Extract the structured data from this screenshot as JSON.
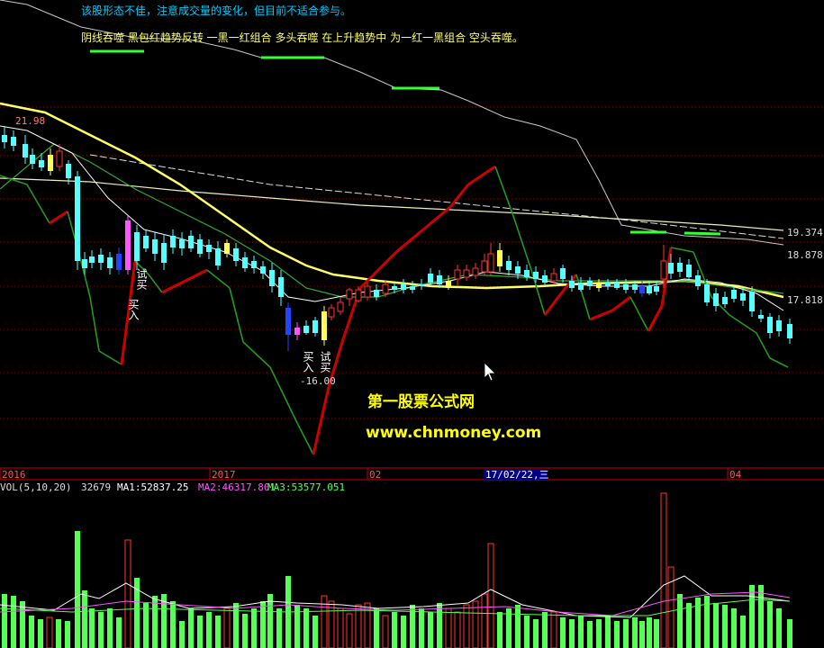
{
  "header": {
    "line1": "该股形态不佳，注意成交量的变化，但目前不适合参与。",
    "line2": "阴线吞噬  黑包红趋势反转  一黑一红组合  多头吞噬  在上升趋势中  为一红一黑组合  空头吞噬。"
  },
  "watermark": {
    "title": "第一股票公式网",
    "url": "www.chnmoney.com"
  },
  "price_axis": {
    "labels": [
      "21.98",
      "19.374",
      "18.878",
      "17.818",
      "-16.00"
    ]
  },
  "date_axis": {
    "labels": [
      "2016",
      "2017",
      "02",
      "17/02/22,三",
      "04"
    ]
  },
  "signals": [
    {
      "text": "试买",
      "ref": "s1"
    },
    {
      "text": "买入",
      "ref": "s2"
    },
    {
      "text": "买入",
      "ref": "s3"
    },
    {
      "text": "试买",
      "ref": "s4"
    }
  ],
  "volume_panel": {
    "label": "VOL(5,10,20)",
    "value": "32679",
    "ma1_label": "MA1:52837.25",
    "ma2_label": "MA2:46317.801",
    "ma3_label": "MA3:53577.051",
    "colors": {
      "ma1": "#ffffff",
      "ma2": "#ff55ff",
      "ma3": "#55ff55"
    }
  },
  "colors": {
    "up": "#ff3333",
    "down": "#55ffff",
    "ma_fast": "#ffffff",
    "ma_slow": "#ffff66",
    "band_up": "#c8c8c8",
    "band_mid": "#33aa33",
    "trend_up": "#cc0000",
    "trend_down": "#229922",
    "vol_up": "#ff3333",
    "vol_down": "#55ff55",
    "grid": "#990000",
    "header_text": "#00ccff",
    "header_text2": "#ffff00",
    "watermark": "#ffff00"
  },
  "cursor": {
    "icon": "arrow-cursor-icon"
  }
}
